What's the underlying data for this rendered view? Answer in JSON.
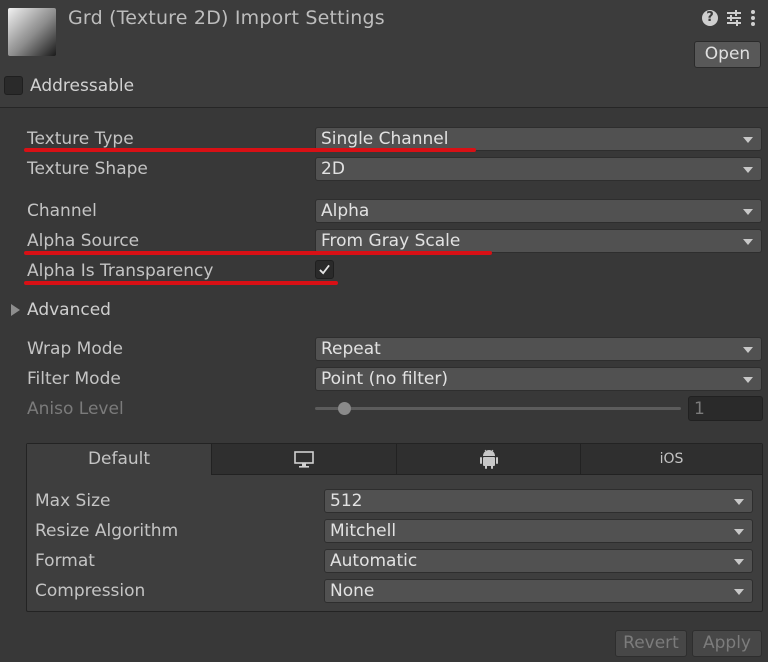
{
  "header": {
    "title": "Grd (Texture 2D) Import Settings",
    "open_label": "Open",
    "icons": [
      "help-icon",
      "preset-sliders-icon",
      "kebab-menu-icon"
    ]
  },
  "addressable": {
    "label": "Addressable",
    "checked": false
  },
  "fields": {
    "texture_type": {
      "label": "Texture Type",
      "value": "Single Channel"
    },
    "texture_shape": {
      "label": "Texture Shape",
      "value": "2D"
    },
    "channel": {
      "label": "Channel",
      "value": "Alpha"
    },
    "alpha_source": {
      "label": "Alpha Source",
      "value": "From Gray Scale"
    },
    "alpha_is_transparency": {
      "label": "Alpha Is Transparency",
      "checked": true
    },
    "advanced": {
      "label": "Advanced",
      "expanded": false
    },
    "wrap_mode": {
      "label": "Wrap Mode",
      "value": "Repeat"
    },
    "filter_mode": {
      "label": "Filter Mode",
      "value": "Point (no filter)"
    },
    "aniso_level": {
      "label": "Aniso Level",
      "value": "1",
      "disabled": true
    }
  },
  "platform_tabs": [
    {
      "label": "Default",
      "icon": "",
      "active": true
    },
    {
      "label": "",
      "icon": "monitor-icon",
      "active": false
    },
    {
      "label": "",
      "icon": "android-icon",
      "active": false
    },
    {
      "label": "iOS",
      "icon": "",
      "active": false
    }
  ],
  "platform_settings": {
    "max_size": {
      "label": "Max Size",
      "value": "512"
    },
    "resize_algorithm": {
      "label": "Resize Algorithm",
      "value": "Mitchell"
    },
    "format": {
      "label": "Format",
      "value": "Automatic"
    },
    "compression": {
      "label": "Compression",
      "value": "None"
    }
  },
  "footer": {
    "revert_label": "Revert",
    "apply_label": "Apply"
  },
  "colors": {
    "background": "#383838",
    "highlight_underline": "#d81015",
    "text": "#c4c4c4"
  }
}
